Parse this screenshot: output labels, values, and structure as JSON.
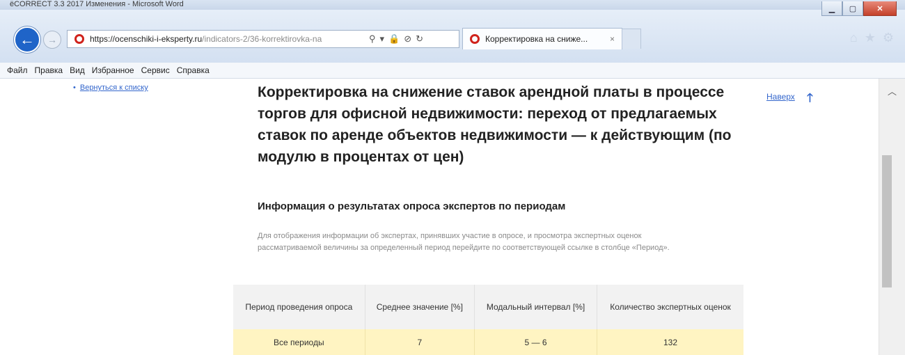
{
  "window": {
    "title_fragment": "ёCORRECT 3.3 2017 Изменения - Microsoft Word"
  },
  "browser": {
    "url_host": "https://ocenschiki-i-eksperty.ru",
    "url_path": "/indicators-2/36-korrektirovka-na",
    "tab_title": "Корректировка на сниже...",
    "tab_close": "×"
  },
  "menu": [
    "Файл",
    "Правка",
    "Вид",
    "Избранное",
    "Сервис",
    "Справка"
  ],
  "page": {
    "back_link": "Вернуться к списку",
    "title": "Корректировка на снижение ставок арендной платы в процессе торгов для офисной недвижимости: переход от предлагаемых ставок по аренде объектов недвижимости — к действующим (по модулю в процентах от цен)",
    "top_link": "Наверх",
    "top_arrow": "🡑",
    "section_title": "Информация о результатах опроса экспертов по периодам",
    "section_desc": "Для отображения информации об экспертах, принявших участие в опросе, и просмотра экспертных оценок рассматриваемой величины за определенный период перейдите по соответствующей ссылке в столбце «Период».",
    "table": {
      "headers": [
        "Период проведения опроса",
        "Среднее значение [%]",
        "Модальный интервал [%]",
        "Количество экспертных оценок"
      ],
      "rows": [
        [
          "Все периоды",
          "7",
          "5 — 6",
          "132"
        ]
      ]
    }
  }
}
